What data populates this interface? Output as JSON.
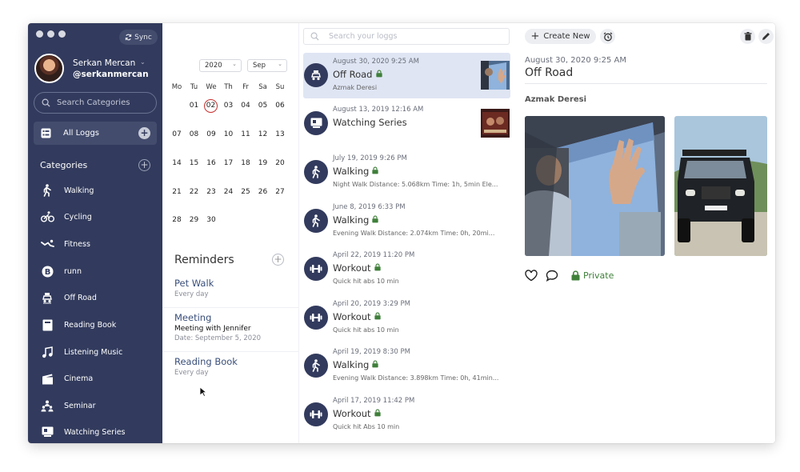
{
  "window": {
    "sync_label": "Sync"
  },
  "user": {
    "name": "Serkan Mercan",
    "handle": "@serkanmercan"
  },
  "sidebar": {
    "search_placeholder": "Search Categories",
    "all_loggs_label": "All Loggs",
    "categories_title": "Categories",
    "categories": [
      {
        "label": "Walking",
        "icon": "walking-icon"
      },
      {
        "label": "Cycling",
        "icon": "cycling-icon"
      },
      {
        "label": "Fitness",
        "icon": "fitness-icon"
      },
      {
        "label": "runn",
        "icon": "bitcoin-icon"
      },
      {
        "label": "Off Road",
        "icon": "off-road-icon"
      },
      {
        "label": "Reading Book",
        "icon": "book-icon"
      },
      {
        "label": "Listening Music",
        "icon": "music-icon"
      },
      {
        "label": "Cinema",
        "icon": "clapper-icon"
      },
      {
        "label": "Seminar",
        "icon": "seminar-icon"
      },
      {
        "label": "Watching Series",
        "icon": "series-icon"
      }
    ]
  },
  "calendar": {
    "year": "2020",
    "month": "Sep",
    "weekdays": [
      "Mo",
      "Tu",
      "We",
      "Th",
      "Fr",
      "Sa",
      "Su"
    ],
    "weeks": [
      [
        "",
        "01",
        "02",
        "03",
        "04",
        "05",
        "06"
      ],
      [
        "07",
        "08",
        "09",
        "10",
        "11",
        "12",
        "13"
      ],
      [
        "14",
        "15",
        "16",
        "17",
        "18",
        "19",
        "20"
      ],
      [
        "21",
        "22",
        "23",
        "24",
        "25",
        "26",
        "27"
      ],
      [
        "28",
        "29",
        "30",
        "",
        "",
        "",
        ""
      ]
    ],
    "today": "02"
  },
  "reminders": {
    "title": "Reminders",
    "items": [
      {
        "title": "Pet Walk",
        "subtitle": "",
        "meta": "Every day"
      },
      {
        "title": "Meeting",
        "subtitle": "Meeting with Jennifer",
        "meta": "Date: September 5, 2020"
      },
      {
        "title": "Reading Book",
        "subtitle": "",
        "meta": "Every day"
      }
    ]
  },
  "log_list": {
    "search_placeholder": "Search your loggs",
    "entries": [
      {
        "date": "August 30, 2020 9:25 AM",
        "title": "Off Road",
        "subtitle": "Azmak Deresi",
        "icon": "off-road-icon",
        "locked": true,
        "thumb": "offroad"
      },
      {
        "date": "August 13, 2019 12:16 AM",
        "title": "Watching Series",
        "subtitle": "",
        "icon": "series-icon",
        "locked": false,
        "thumb": "series"
      },
      {
        "date": "July 19, 2019 9:26 PM",
        "title": "Walking",
        "subtitle": "Night Walk Distance: 5.068km Time: 1h, 5min Ele...",
        "icon": "walking-icon",
        "locked": true,
        "thumb": ""
      },
      {
        "date": "June 8, 2019 6:33 PM",
        "title": "Walking",
        "subtitle": "Evening Walk Distance: 2.074km Time: 0h, 20mi...",
        "icon": "walking-icon",
        "locked": true,
        "thumb": ""
      },
      {
        "date": "April 22, 2019 11:20 PM",
        "title": "Workout",
        "subtitle": "Quick hit abs 10 min",
        "icon": "dumbbell-icon",
        "locked": true,
        "thumb": ""
      },
      {
        "date": "April 20, 2019 3:29 PM",
        "title": "Workout",
        "subtitle": "Quick hit abs 10 min",
        "icon": "dumbbell-icon",
        "locked": true,
        "thumb": ""
      },
      {
        "date": "April 19, 2019 8:30 PM",
        "title": "Walking",
        "subtitle": "Evening Walk Distance: 3.898km Time: 0h, 41min...",
        "icon": "walking-icon",
        "locked": true,
        "thumb": ""
      },
      {
        "date": "April 17, 2019 11:42 PM",
        "title": "Workout",
        "subtitle": "Quick hit Abs 10 min",
        "icon": "dumbbell-icon",
        "locked": true,
        "thumb": ""
      }
    ]
  },
  "detail": {
    "create_new_label": "Create New",
    "date": "August 30, 2020 9:25 AM",
    "title": "Off Road",
    "location": "Azmak Deresi",
    "privacy_label": "Private"
  },
  "colors": {
    "sidebar": "#323b5d",
    "active_entry": "#dfe5f3",
    "private": "#3f7f3a",
    "reminder_title": "#3a4f7a"
  }
}
